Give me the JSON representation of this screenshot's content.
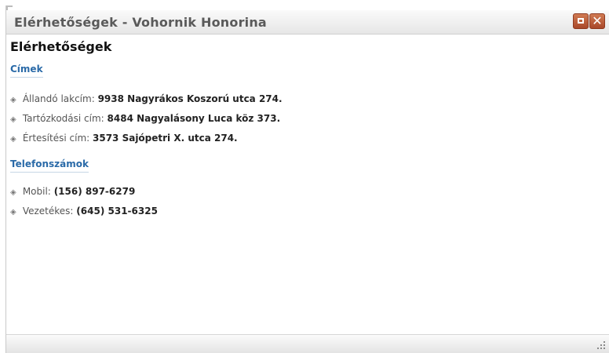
{
  "window": {
    "title": "Elérhetőségek - Vohornik Honorina",
    "maximize_icon": "maximize-icon",
    "close_icon": "close-icon",
    "close_glyph": "✕"
  },
  "main": {
    "page_title": "Elérhetőségek",
    "addresses": {
      "heading": "Címek",
      "items": [
        {
          "label": "Állandó lakcím:",
          "value": "9938 Nagyrákos Koszorú utca 274."
        },
        {
          "label": "Tartózkodási cím:",
          "value": "8484 Nagyalásony Luca köz 373."
        },
        {
          "label": "Értesítési cím:",
          "value": "3573 Sajópetri X. utca 274."
        }
      ]
    },
    "phones": {
      "heading": "Telefonszámok",
      "items": [
        {
          "label": "Mobil:",
          "value": "(156) 897-6279"
        },
        {
          "label": "Vezetékes:",
          "value": "(645) 531-6325"
        }
      ]
    }
  },
  "icons": {
    "bullet": "diamond-bullet-icon",
    "resize": "resize-grip-icon"
  },
  "colors": {
    "heading_accent": "#2a6aa8",
    "window_button": "#b8552f"
  }
}
